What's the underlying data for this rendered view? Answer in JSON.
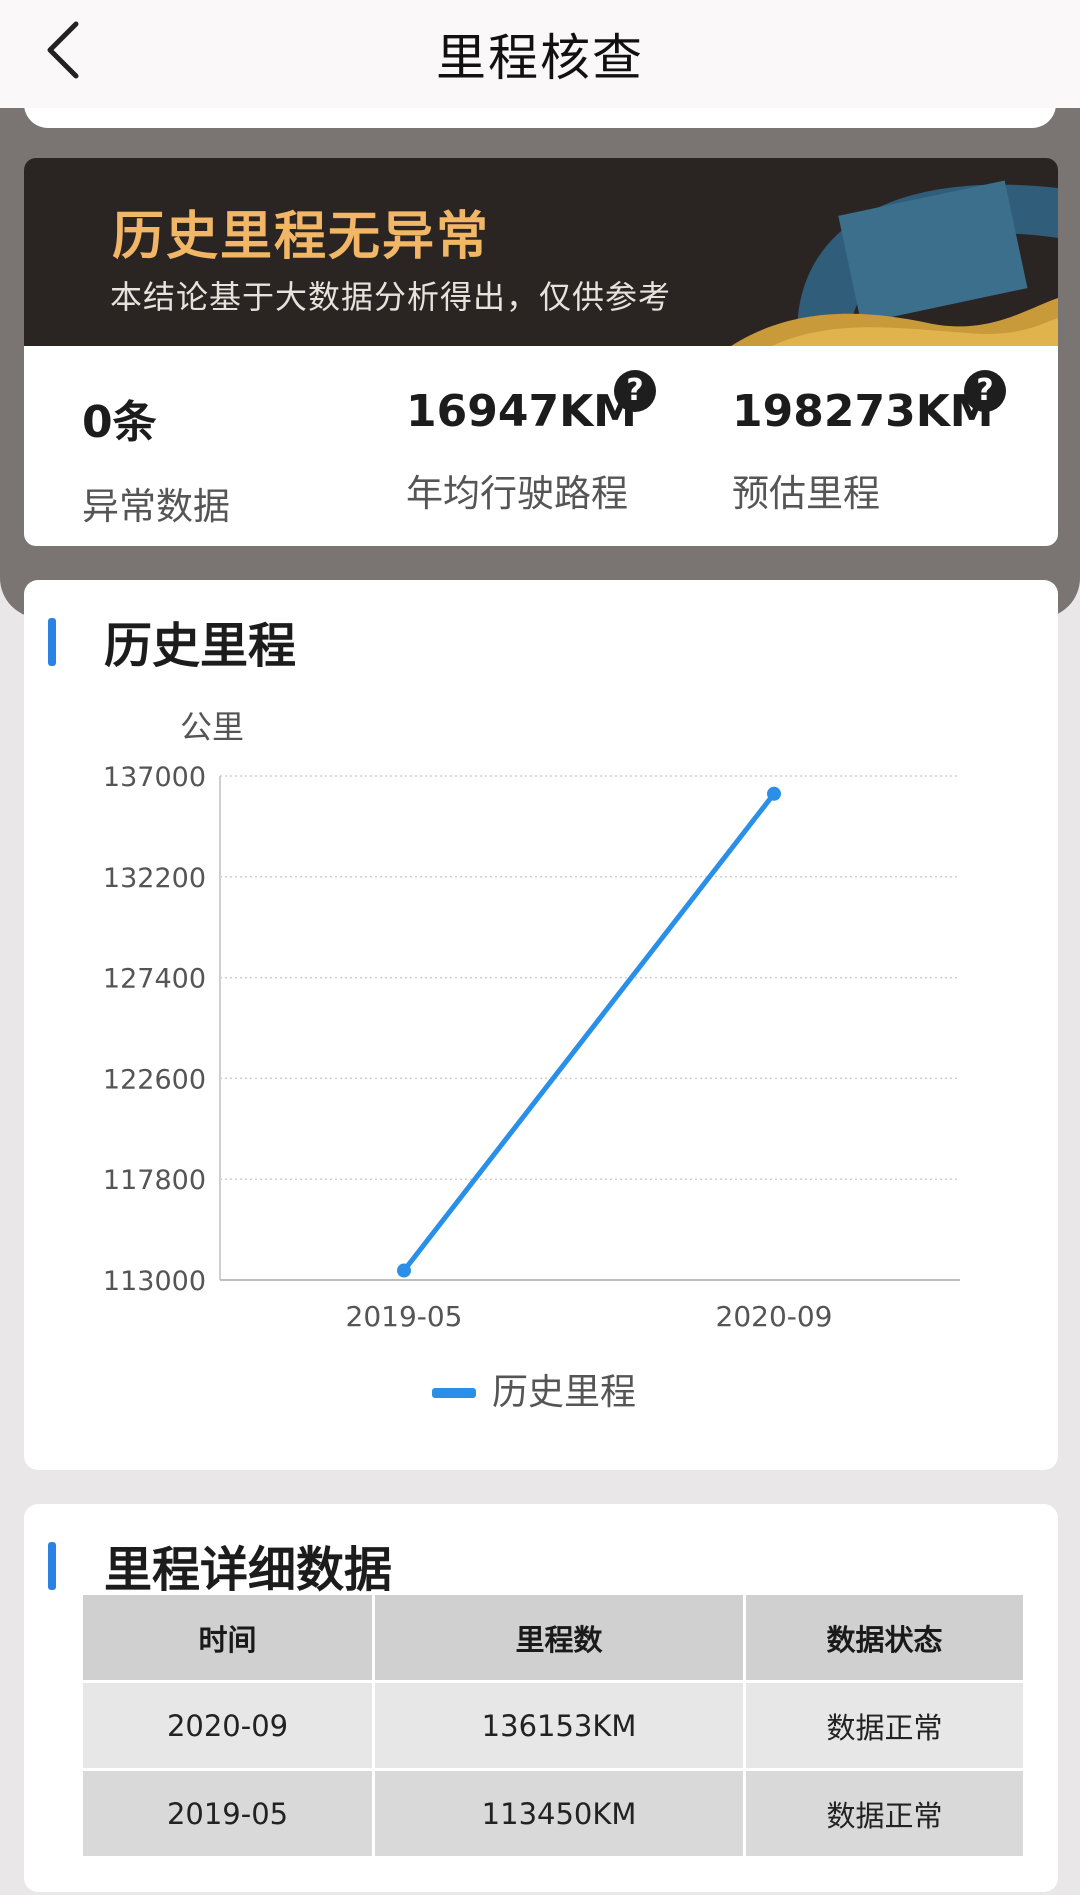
{
  "header": {
    "title": "里程核查"
  },
  "banner": {
    "headline": "历史里程无异常",
    "subtitle": "本结论基于大数据分析得出，仅供参考"
  },
  "stats": [
    {
      "value": "0条",
      "label": "异常数据",
      "help": false
    },
    {
      "value": "16947KM",
      "label": "年均行驶路程",
      "help": true
    },
    {
      "value": "198273KM",
      "label": "预估里程",
      "help": true
    }
  ],
  "help_glyph": "?",
  "history": {
    "title": "历史里程",
    "chart_data": {
      "type": "line",
      "title": "",
      "ylabel": "公里",
      "xlabel": "",
      "x": [
        "2019-05",
        "2020-09"
      ],
      "yticks": [
        "137000",
        "132200",
        "127400",
        "122600",
        "117800",
        "113000"
      ],
      "ylim": [
        113000,
        137000
      ],
      "series": [
        {
          "name": "历史里程",
          "values": [
            113450,
            136153
          ],
          "color": "#2a8fe8"
        }
      ],
      "grid": true,
      "legend": "bottom-center"
    }
  },
  "detail": {
    "title": "里程详细数据",
    "columns": [
      "时间",
      "里程数",
      "数据状态"
    ],
    "rows": [
      [
        "2020-09",
        "136153KM",
        "数据正常"
      ],
      [
        "2019-05",
        "113450KM",
        "数据正常"
      ]
    ]
  },
  "colors": {
    "accent": "#2a82e4",
    "banner_text": "#f2b667"
  }
}
